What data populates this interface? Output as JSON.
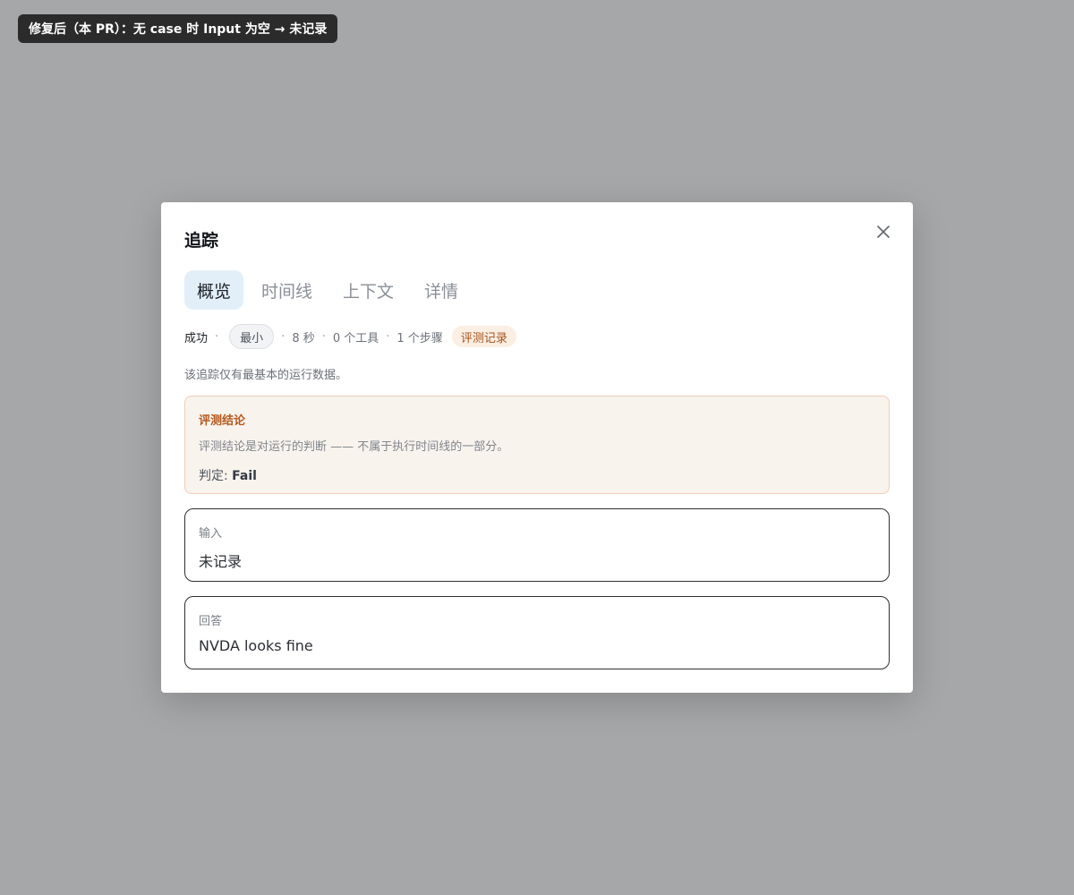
{
  "banner": "修复后（本 PR）：无 case 时 Input 为空 → 未记录",
  "modal": {
    "title": "追踪",
    "tabs": [
      {
        "label": "概览",
        "active": true
      },
      {
        "label": "时间线",
        "active": false
      },
      {
        "label": "上下文",
        "active": false
      },
      {
        "label": "详情",
        "active": false
      }
    ],
    "meta": {
      "status": "成功",
      "level_badge": "最小",
      "duration": "8 秒",
      "tools": "0 个工具",
      "steps": "1 个步骤",
      "eval_badge": "评测记录"
    },
    "note": "该追踪仅有最基本的运行数据。",
    "evaluation": {
      "title": "评测结论",
      "description": "评测结论是对运行的判断 —— 不属于执行时间线的一部分。",
      "verdict_label": "判定:",
      "verdict_value": "Fail"
    },
    "input": {
      "label": "输入",
      "value": "未记录"
    },
    "answer": {
      "label": "回答",
      "value": "NVDA looks fine"
    }
  },
  "colors": {
    "backdrop": "#a6a7a9",
    "active_tab_bg": "#e3eff8",
    "eval_accent": "#b3591c",
    "eval_bg": "#f9f3ee"
  }
}
